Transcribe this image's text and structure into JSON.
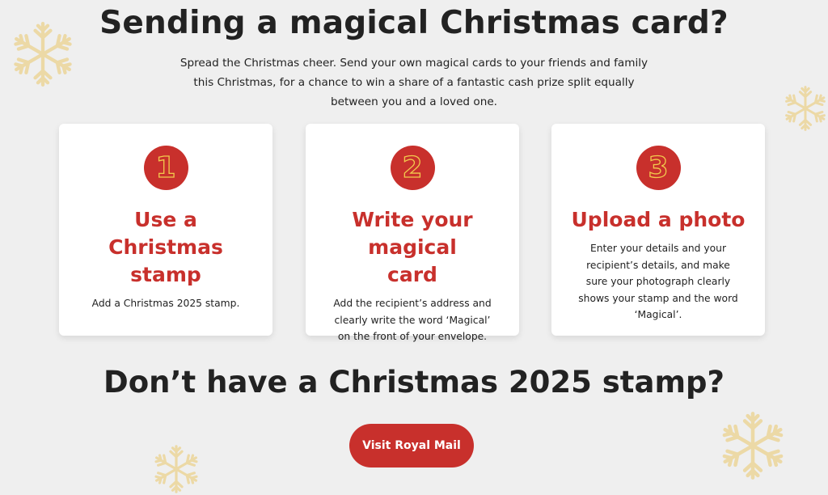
{
  "header": {
    "title": "Sending a magical Christmas card?",
    "intro": "Spread the Christmas cheer. Send your own magical cards to your friends and family this Christmas, for a chance to win a share of a fantastic cash prize split equally between you and a loved one."
  },
  "steps": [
    {
      "number": "1",
      "title": "Use a Christmas stamp",
      "text": "Add a Christmas 2025 stamp."
    },
    {
      "number": "2",
      "title": "Write your magical card",
      "text": "Add the recipient’s address and clearly write the word ‘Magical’ on the front of your envelope."
    },
    {
      "number": "3",
      "title": "Upload a photo",
      "text": "Enter your details and your recipient’s details, and make sure your photograph clearly shows your stamp and the word ‘Magical’."
    }
  ],
  "cta_section": {
    "title": "Don’t have a Christmas 2025 stamp?",
    "button_label": "Visit Royal Mail"
  },
  "decorations": {
    "icon": "snowflake-icon",
    "color": "#ecd9a6"
  },
  "colors": {
    "accent": "#c8302c",
    "number_outline": "#f2c94c",
    "background": "#efefef"
  }
}
